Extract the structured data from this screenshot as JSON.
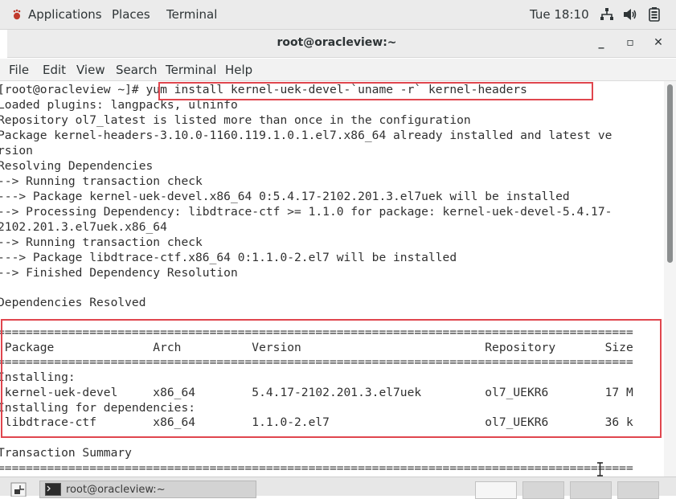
{
  "top_panel": {
    "applications_label": "Applications",
    "places_label": "Places",
    "terminal_label": "Terminal",
    "clock": "Tue 18:10",
    "icons": [
      "network-icon",
      "volume-icon",
      "battery-icon"
    ]
  },
  "window": {
    "title": "root@oracleview:~",
    "minimize_glyph": "_",
    "maximize_glyph": "▫",
    "close_glyph": "✕"
  },
  "menu": {
    "items": [
      "File",
      "Edit",
      "View",
      "Search",
      "Terminal",
      "Help"
    ]
  },
  "terminal": {
    "lines": [
      "[root@oracleview ~]# yum install kernel-uek-devel-`uname -r` kernel-headers",
      "Loaded plugins: langpacks, ulninfo",
      "Repository ol7_latest is listed more than once in the configuration",
      "Package kernel-headers-3.10.0-1160.119.1.0.1.el7.x86_64 already installed and latest ve",
      "rsion",
      "Resolving Dependencies",
      "--> Running transaction check",
      "---> Package kernel-uek-devel.x86_64 0:5.4.17-2102.201.3.el7uek will be installed",
      "--> Processing Dependency: libdtrace-ctf >= 1.1.0 for package: kernel-uek-devel-5.4.17-",
      "2102.201.3.el7uek.x86_64",
      "--> Running transaction check",
      "---> Package libdtrace-ctf.x86_64 0:1.1.0-2.el7 will be installed",
      "--> Finished Dependency Resolution",
      "",
      "Dependencies Resolved",
      "",
      "==========================================================================================",
      " Package              Arch          Version                          Repository       Size",
      "==========================================================================================",
      "Installing:",
      " kernel-uek-devel     x86_64        5.4.17-2102.201.3.el7uek         ol7_UEKR6        17 M",
      "Installing for dependencies:",
      " libdtrace-ctf        x86_64        1.1.0-2.el7                      ol7_UEKR6        36 k",
      "",
      "Transaction Summary",
      "=========================================================================================="
    ]
  },
  "taskbar": {
    "task_label": "root@oracleview:~"
  },
  "colors": {
    "highlight": "#e0464e",
    "terminal_text": "#303030"
  }
}
